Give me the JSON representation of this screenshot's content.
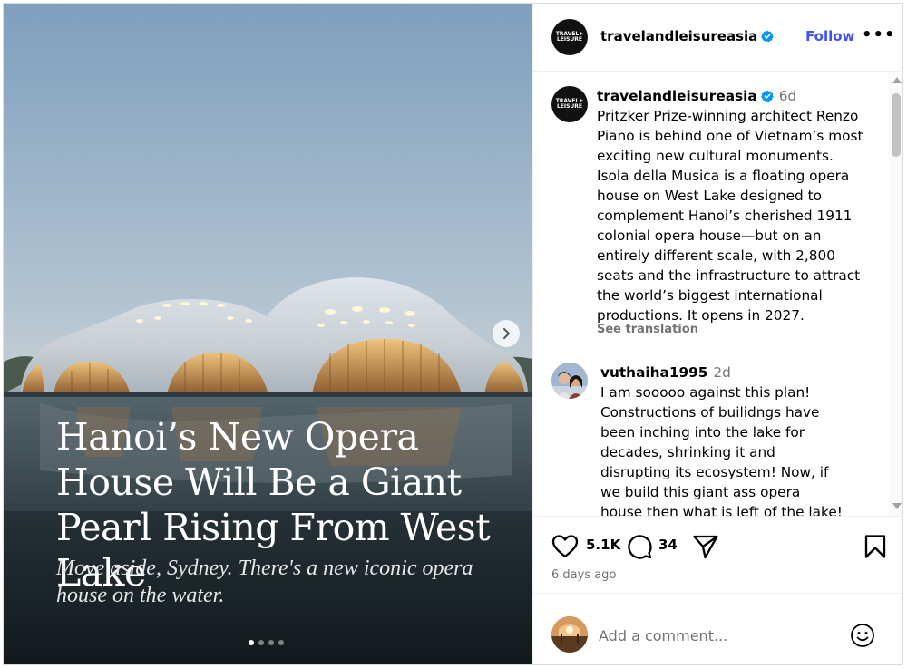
{
  "media": {
    "headline": "Hanoi’s New Opera House Will Be a Giant Pearl Rising From West Lake",
    "subhead": "Move aside, Sydney. There's a new iconic opera house on the water.",
    "carousel": {
      "slide_count": 4,
      "current_slide": 1
    },
    "next_icon": "chevron-right-icon"
  },
  "header": {
    "username": "travelandleisureasia",
    "avatar_text_line1": "TRAVEL+",
    "avatar_text_line2": "LEISURE",
    "follow_label": "Follow",
    "more_label": "•••",
    "verified_icon": "verified-badge-icon"
  },
  "caption": {
    "username": "travelandleisureasia",
    "time": "6d",
    "text": "Pritzker Prize-winning architect Renzo Piano is behind one of Vietnam’s most exciting new cultural monuments. Isola della Musica is a floating opera house on West Lake designed to complement Hanoi’s cherished 1911 colonial opera house—but on an entirely different scale, with 2,800 seats and the infrastructure to attract the world’s biggest international productions. It opens in 2027.",
    "see_translation": "See translation"
  },
  "comment": {
    "username": "vuthaiha1995",
    "time": "2d",
    "text": "I am sooooo against this plan! Constructions of builidngs have been inching into the lake for decades, shrinking it and disrupting its ecosystem! Now, if we build this giant ass opera house then what is left of the lake!"
  },
  "actions": {
    "likes": "5.1K",
    "comments": "34",
    "post_age": "6 days ago",
    "icons": [
      "heart-icon",
      "comment-icon",
      "share-icon",
      "bookmark-icon"
    ]
  },
  "add_comment": {
    "placeholder": "Add a comment...",
    "emoji_icon": "emoji-icon"
  },
  "colors": {
    "accent_blue": "#4150f7",
    "verified_blue": "#0095f6",
    "muted_text": "#737373",
    "border": "#dbdbdb"
  }
}
